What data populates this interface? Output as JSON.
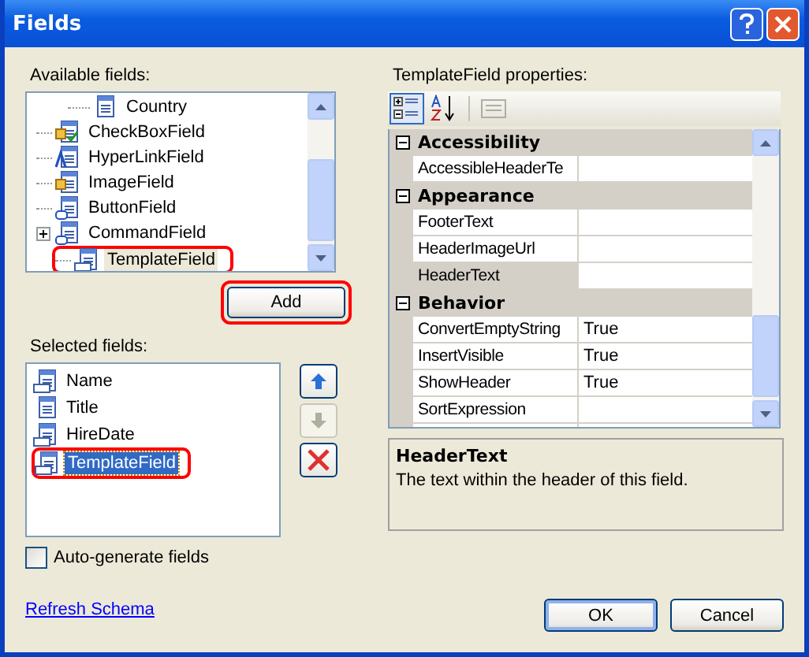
{
  "window": {
    "title": "Fields"
  },
  "available_fields": {
    "label": "Available fields:",
    "items": [
      {
        "children": [
          {
            "label": "Country",
            "kind": "column",
            "selected": false
          }
        ]
      },
      {
        "label": "CheckBoxField",
        "kind": "checkbox",
        "selected": false,
        "annotated": false
      },
      {
        "label": "HyperLinkField",
        "kind": "hyperlink",
        "selected": false,
        "annotated": false
      },
      {
        "label": "ImageField",
        "kind": "image",
        "selected": false,
        "annotated": false
      },
      {
        "label": "ButtonField",
        "kind": "button",
        "selected": false,
        "annotated": false
      },
      {
        "label": "CommandField",
        "kind": "button",
        "selected": false,
        "annotated": false,
        "expanded": false
      },
      {
        "label": "TemplateField",
        "kind": "template",
        "selected": true,
        "annotated": true
      }
    ]
  },
  "add_button": {
    "label": "Add",
    "annotated": true
  },
  "selected_fields": {
    "label": "Selected fields:",
    "items": [
      {
        "label": "Name",
        "kind": "template",
        "selected": false,
        "annotated": false
      },
      {
        "label": "Title",
        "kind": "column",
        "selected": false,
        "annotated": false
      },
      {
        "label": "HireDate",
        "kind": "template",
        "selected": false,
        "annotated": false
      },
      {
        "label": "TemplateField",
        "kind": "template",
        "selected": true,
        "annotated": true
      }
    ]
  },
  "move_buttons": [
    {
      "kind": "up",
      "disabled": false
    },
    {
      "kind": "down",
      "disabled": true
    },
    {
      "kind": "delete",
      "disabled": false
    }
  ],
  "auto_generate": {
    "label": "Auto-generate fields",
    "checked": false
  },
  "refresh_link": "Refresh Schema",
  "properties": {
    "label": "TemplateField properties:",
    "toolbar": [
      {
        "kind": "categorized",
        "selected": true
      },
      {
        "kind": "alphabetical",
        "selected": false
      },
      {
        "kind": "pages",
        "disabled": true
      }
    ],
    "categories": [
      {
        "name": "Accessibility",
        "expanded": true,
        "rows": [
          {
            "name": "AccessibleHeaderTe",
            "selected": false
          }
        ]
      },
      {
        "name": "Appearance",
        "expanded": true,
        "rows": [
          {
            "name": "FooterText",
            "selected": false
          },
          {
            "name": "HeaderImageUrl",
            "selected": false
          },
          {
            "name": "HeaderText",
            "selected": true
          }
        ]
      },
      {
        "name": "Behavior",
        "expanded": true,
        "rows": [
          {
            "name": "ConvertEmptyString",
            "value": "True",
            "selected": false
          },
          {
            "name": "InsertVisible",
            "value": "True",
            "selected": false
          },
          {
            "name": "ShowHeader",
            "value": "True",
            "selected": false
          },
          {
            "name": "SortExpression",
            "selected": false
          }
        ]
      }
    ]
  },
  "description": {
    "title": "HeaderText",
    "text": "The text within the header of this field."
  },
  "buttons": [
    {
      "label": "OK",
      "default": true
    },
    {
      "label": "Cancel",
      "default": false
    }
  ]
}
